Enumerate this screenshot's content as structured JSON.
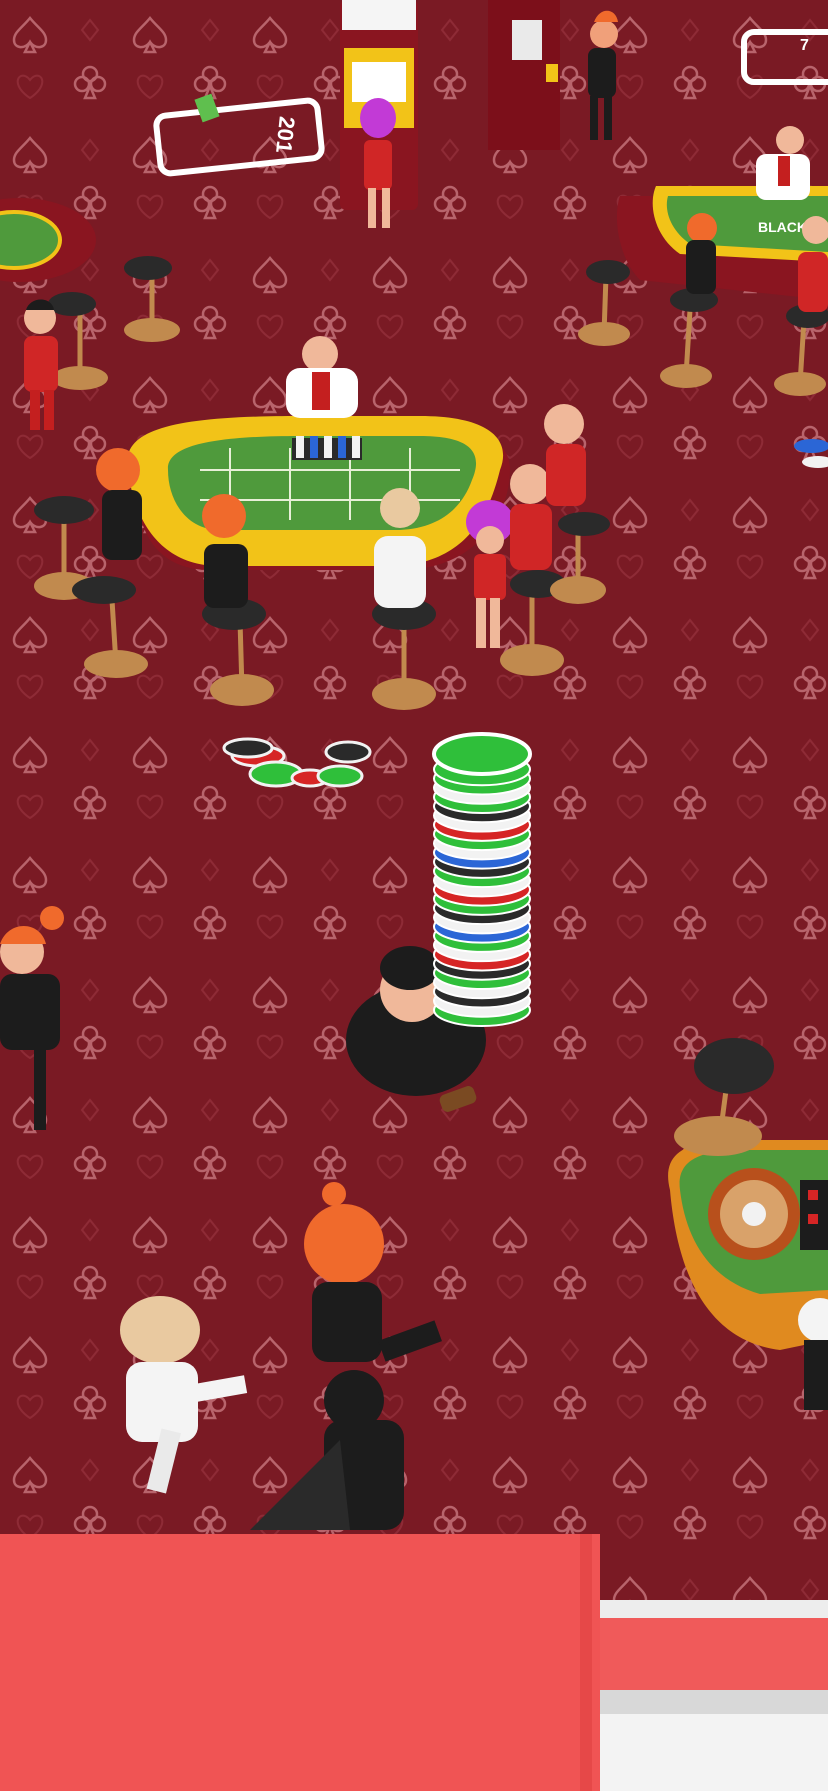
{
  "game": {
    "floor_color": "#7a1a24",
    "pattern_color": "#b8646c",
    "felt_color": "#4f9a3c",
    "table_rim_color": "#f2c318",
    "spot_labels": [
      "201",
      "7"
    ],
    "table_label": "BLACKJACK"
  },
  "player": {
    "chip_stack_count": 27,
    "chip_colors": [
      "#2fbf3a",
      "#f2f2f2",
      "#2a2a2a",
      "#d62525",
      "#2b66d6"
    ]
  }
}
